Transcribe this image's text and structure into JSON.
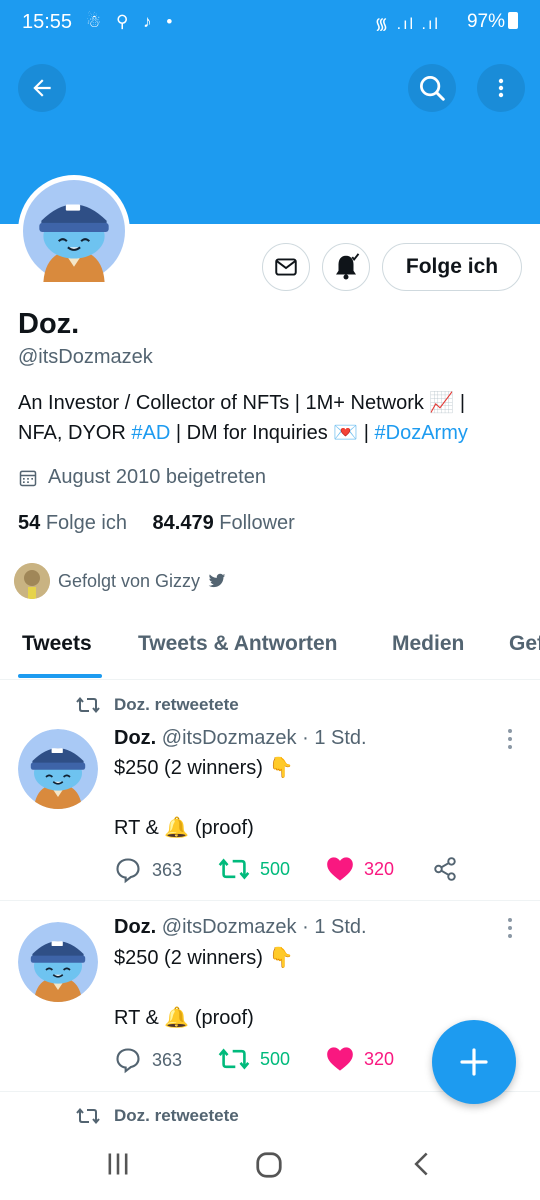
{
  "status_bar": {
    "time": "15:55",
    "battery": "97%"
  },
  "profile": {
    "name": "Doz.",
    "handle": "@itsDozmazek",
    "bio_part1": "An Investor / Collector of NFTs | 1M+ Network 📈 |",
    "bio_part2": "NFA, DYOR ",
    "bio_tag1": "#AD",
    "bio_part3": " | DM for Inquiries 💌 | ",
    "bio_tag2": "#DozArmy",
    "joined": "August 2010 beigetreten",
    "following_count": "54",
    "following_label": "Folge ich",
    "followers_count": "84.479",
    "followers_label": "Follower",
    "followed_by": "Gefolgt von Gizzy",
    "follow_button": "Folge ich"
  },
  "tabs": [
    "Tweets",
    "Tweets & Antworten",
    "Medien",
    "Gef"
  ],
  "tweets": [
    {
      "retweeted_by": "Doz. retweetete",
      "name": "Doz.",
      "handle_time": "@itsDozmazek · 1 Std.",
      "line1": "$250 (2 winners) 👇",
      "line2": "RT & 🔔 (proof)",
      "replies": "363",
      "retweets": "500",
      "likes": "320"
    },
    {
      "name": "Doz.",
      "handle_time": "@itsDozmazek · 1 Std.",
      "line1": "$250 (2 winners) 👇",
      "line2": "RT & 🔔 (proof)",
      "replies": "363",
      "retweets": "500",
      "likes": "320"
    }
  ],
  "next_retweeted_by": "Doz. retweetete",
  "colors": {
    "accent": "#1d9bf0",
    "retweet": "#00ba7c",
    "like": "#f91880"
  },
  "icons": [
    "back-arrow-icon",
    "search-icon",
    "more-vertical-icon",
    "mail-icon",
    "bell-icon",
    "calendar-icon",
    "verified-bird-icon",
    "reply-icon",
    "retweet-icon",
    "heart-icon",
    "share-icon",
    "compose-plus-icon"
  ]
}
